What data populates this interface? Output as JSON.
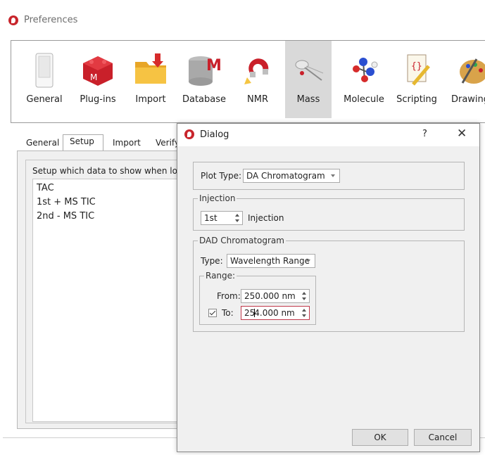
{
  "window": {
    "title": "Preferences"
  },
  "toolbar": {
    "items": [
      {
        "label": "General",
        "icon": "general-icon"
      },
      {
        "label": "Plug-ins",
        "icon": "plugins-icon"
      },
      {
        "label": "Import",
        "icon": "import-icon"
      },
      {
        "label": "Database",
        "icon": "database-icon"
      },
      {
        "label": "NMR",
        "icon": "nmr-icon"
      },
      {
        "label": "Mass",
        "icon": "mass-icon",
        "active": true
      },
      {
        "label": "Molecule",
        "icon": "molecule-icon"
      },
      {
        "label": "Scripting",
        "icon": "scripting-icon"
      },
      {
        "label": "Drawing",
        "icon": "drawing-icon"
      }
    ]
  },
  "tabs": [
    {
      "label": "General"
    },
    {
      "label": "Setup",
      "selected": true
    },
    {
      "label": "Import"
    },
    {
      "label": "Verify"
    }
  ],
  "setup": {
    "caption": "Setup which data to show when loadin",
    "items": [
      "TAC",
      "1st + MS TIC",
      "2nd - MS TIC"
    ]
  },
  "dialog": {
    "title": "Dialog",
    "help": "?",
    "close": "✕",
    "plot_type": {
      "label": "Plot Type:",
      "value": "DA Chromatogram"
    },
    "injection": {
      "group": "Injection",
      "value": "1st",
      "suffix": "Injection"
    },
    "dad": {
      "group": "DAD Chromatogram",
      "type_label": "Type:",
      "type_value": "Wavelength Range",
      "range": {
        "group": "Range:",
        "from_label": "From:",
        "from_value": "250.000 nm",
        "to_label": "To:",
        "to_checked": true,
        "to_value_before_caret": "25",
        "to_value_after_caret": "4.000 nm"
      }
    },
    "ok": "OK",
    "cancel": "Cancel"
  },
  "colors": {
    "brand": "#c8252c",
    "focus": "#c0394b",
    "active_tool": "#d9d9d9"
  }
}
